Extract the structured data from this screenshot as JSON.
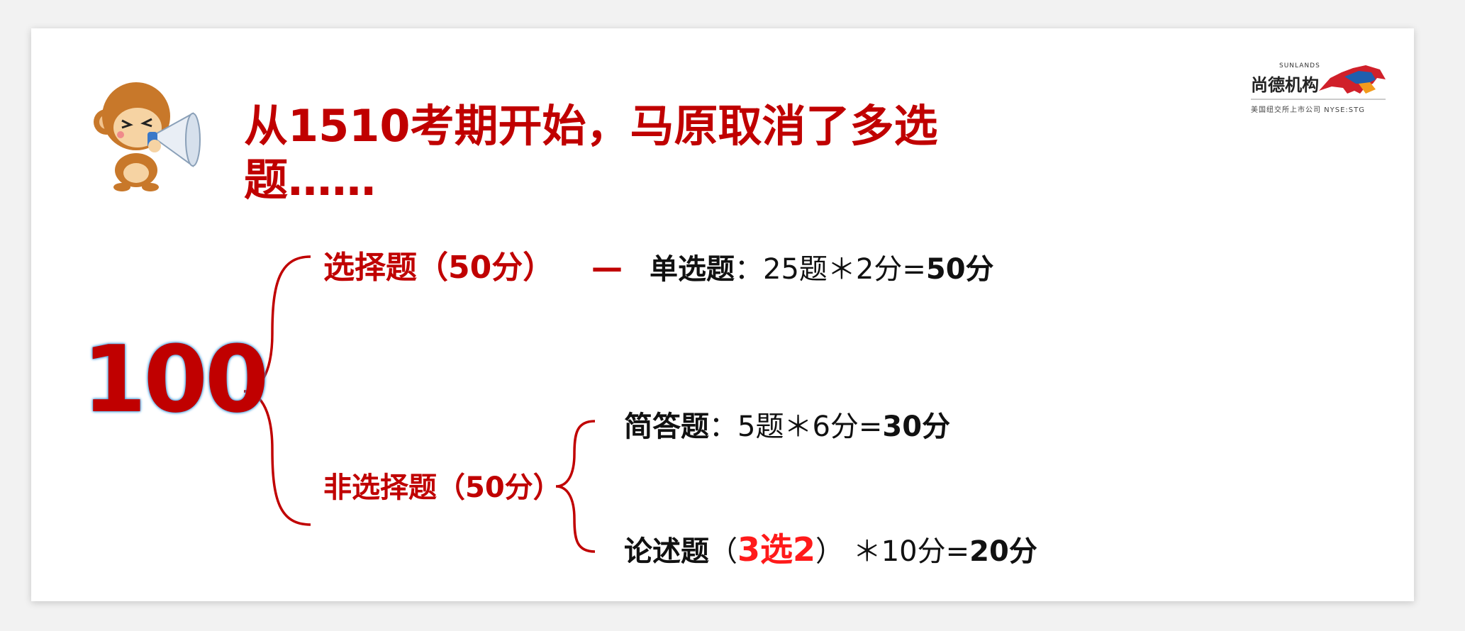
{
  "title": "从1510考期开始，马原取消了多选题……",
  "total": "100",
  "choice": {
    "label": "选择题（50分）",
    "dash": "—",
    "single_name": "单选题",
    "single_formula": "：25题＊2分=",
    "single_total": "50分"
  },
  "nonchoice": {
    "label": "非选择题（50分）",
    "short_name": "简答题",
    "short_formula": "：5题＊6分=",
    "short_total": "30分",
    "essay_name": "论述题",
    "essay_open": "（",
    "essay_pick": "3选2",
    "essay_close": "）",
    "essay_formula": "＊10分=",
    "essay_total": "20分"
  },
  "logo": {
    "en": "SUNLANDS",
    "cn": "尚德机构",
    "sub": "美国纽交所上市公司  NYSE:STG"
  },
  "colors": {
    "title_red": "#c00000",
    "accent_red": "#ff1a1a",
    "number_glow": "#3a96d8"
  }
}
